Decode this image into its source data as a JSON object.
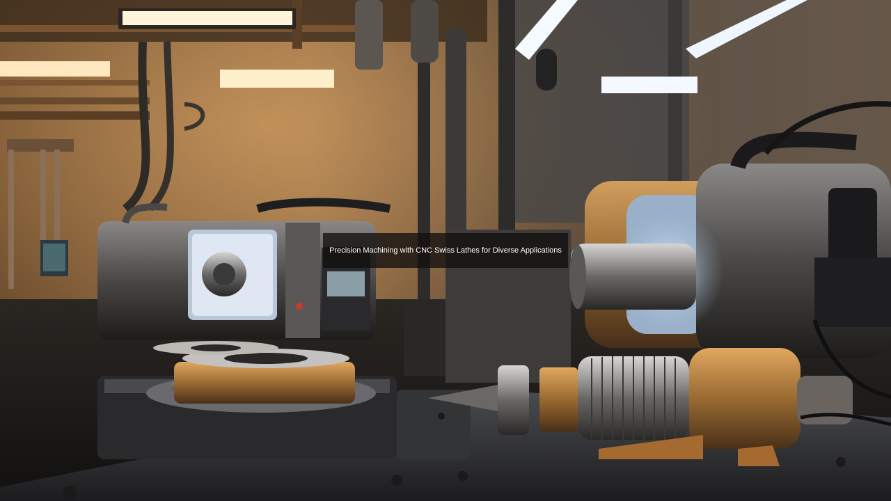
{
  "caption": {
    "text": "Precision Machining with CNC Swiss Lathes for Diverse Applications"
  }
}
